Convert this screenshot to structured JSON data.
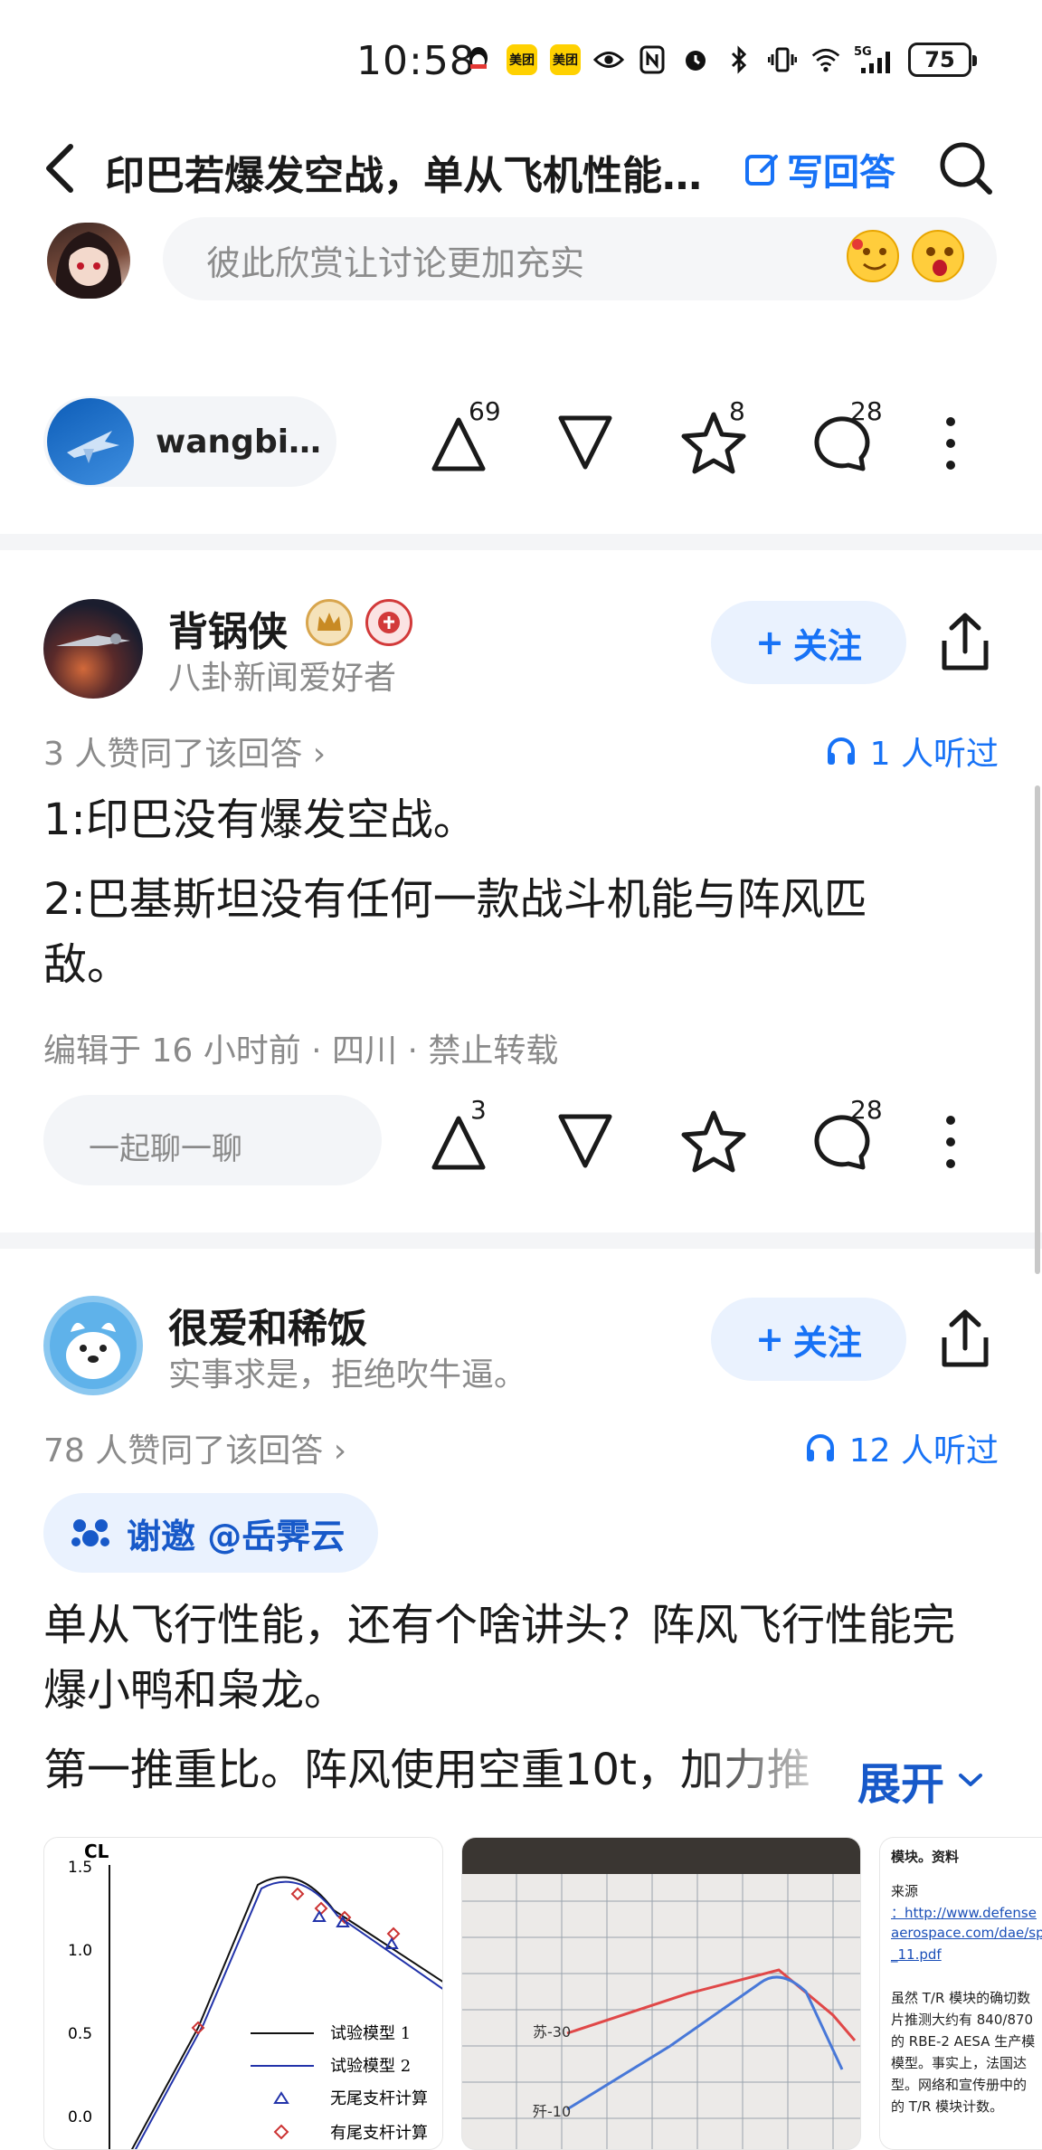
{
  "status_bar": {
    "time": "10:58",
    "app_badges": [
      "美团",
      "美团"
    ],
    "network": "5G",
    "battery": "75"
  },
  "nav": {
    "title": "印巴若爆发空战，单从飞机性能…",
    "write_answer": "写回答"
  },
  "comment": {
    "placeholder": "彼此欣赏让讨论更加充实"
  },
  "top_bar": {
    "author": "wangbi…",
    "upvotes": "69",
    "favorites": "8",
    "comments": "28"
  },
  "answers": [
    {
      "name": "背锅侠",
      "bio": "八卦新闻爱好者",
      "follow": "关注",
      "agree": "3 人赞同了该回答 ›",
      "listens": "1 人听过",
      "paragraphs": [
        "1:印巴没有爆发空战。",
        "2:巴基斯坦没有任何一款战斗机能与阵风匹敌。"
      ],
      "edit": "编辑于 16 小时前 · 四川 · 禁止转载",
      "chat": "一起聊一聊",
      "upvotes": "3",
      "comments": "28"
    },
    {
      "name": "很爱和稀饭",
      "bio": "实事求是，拒绝吹牛逼。",
      "follow": "关注",
      "agree": "78 人赞同了该回答 ›",
      "listens": "12 人听过",
      "invite": "谢邀 @岳霁云",
      "paragraphs": [
        "单从飞行性能，还有个啥讲头？阵风飞行性能完爆小鸭和枭龙。",
        "第一推重比。阵风使用空重10t，加力推"
      ],
      "expand": "展开"
    }
  ],
  "images": {
    "chart": {
      "ylabel": "CL",
      "yticks": [
        "1.5",
        "1.0",
        "0.5",
        "0.0"
      ],
      "legend": [
        "试验模型 1",
        "试验模型 2",
        "无尾支杆计算",
        "有尾支杆计算"
      ]
    },
    "photo": {
      "labels": [
        "苏-30",
        "歼-10"
      ]
    },
    "doc": {
      "lines": [
        "模块。资料",
        "来源",
        "：http://www.defense",
        "aerospace.com/dae/sp",
        "_11.pdf",
        "虽然 T/R 模块的确切数",
        "片推测大约有 840/870",
        "的 RBE-2 AESA 生产模",
        "模型。事实上，法国达",
        "型。网络和宣传册中的",
        "的 T/R 模块计数。"
      ]
    }
  },
  "colors": {
    "accent": "#1772f6",
    "invite_text": "#1759c9"
  }
}
